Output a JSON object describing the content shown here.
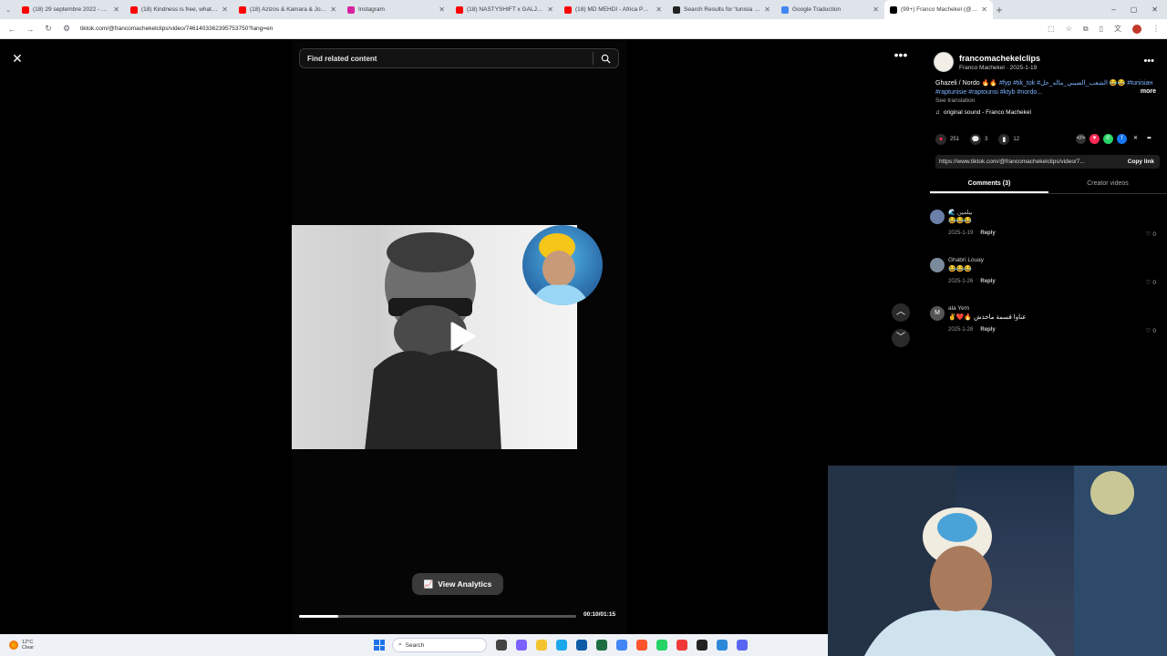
{
  "browser": {
    "tabs": [
      {
        "title": "(18) 29 septembre 2022 - YouTube",
        "color": "#ff0000"
      },
      {
        "title": "(18) Kindness is free, what is ex",
        "color": "#ff0000"
      },
      {
        "title": "(18) Azizos & Kamara & Jougin",
        "color": "#ff0000"
      },
      {
        "title": "Instagram",
        "color": "#d6249f"
      },
      {
        "title": "(18) NASTYSHIFT x GALJY - Ne",
        "color": "#ff0000"
      },
      {
        "title": "(18) MD MEHDI - Africa Portal",
        "color": "#ff0000"
      },
      {
        "title": "Search Results for 'tunisia mus",
        "color": "#222222"
      },
      {
        "title": "Google Traduction",
        "color": "#4285f4"
      },
      {
        "title": "(99+) Franco Machekel (@fran",
        "color": "#000000",
        "active": true
      }
    ],
    "url": "tiktok.com/@francomachekelclips/video/7461403362395753750?lang=en"
  },
  "viewer": {
    "search_placeholder": "Find related content",
    "analytics_label": "View Analytics",
    "time": "00:10/01:15",
    "progress": 0.14
  },
  "panel": {
    "username": "francomachekelclips",
    "subline": "Franco Machekel · 2025-1-19",
    "caption_text": "Ghazeli / Nordo 🔥🔥",
    "caption_hashtags": "#fyp #tik_tok #الشعب_الصيني_ماله_حل 😂😂 #tunisiaн #raptunisie #raptounsi #ktyb #nordo...",
    "more": "more",
    "see_translation": "See translation",
    "sound": "original sound - Franco Machekel",
    "likes": "251",
    "comments_count": "3",
    "saves": "12",
    "link": "https://www.tiktok.com/@francomachekelclips/video/7...",
    "copy_link": "Copy link",
    "tab_comments": "Comments (3)",
    "tab_creator": "Creator videos",
    "comments": [
      {
        "user": "🌊 بيلمين",
        "text": "😂😂😂",
        "date": "2025-1-19",
        "reply": "Reply",
        "likes": "0",
        "avatar": "",
        "color": "#6b7fa8"
      },
      {
        "user": "Ghabri Louay",
        "text": "😂😂😂",
        "date": "2025-1-26",
        "reply": "Reply",
        "likes": "0",
        "avatar": "",
        "color": "#7b8a9a"
      },
      {
        "user": "ala Yem",
        "text": "✌️❤️🔥 عناوا قسمة ماخذش",
        "date": "2025-1-28",
        "reply": "Reply",
        "likes": "0",
        "avatar": "M",
        "color": "#555555"
      }
    ]
  },
  "taskbar": {
    "temp": "12°C",
    "weather": "Clear",
    "search": "Search"
  }
}
